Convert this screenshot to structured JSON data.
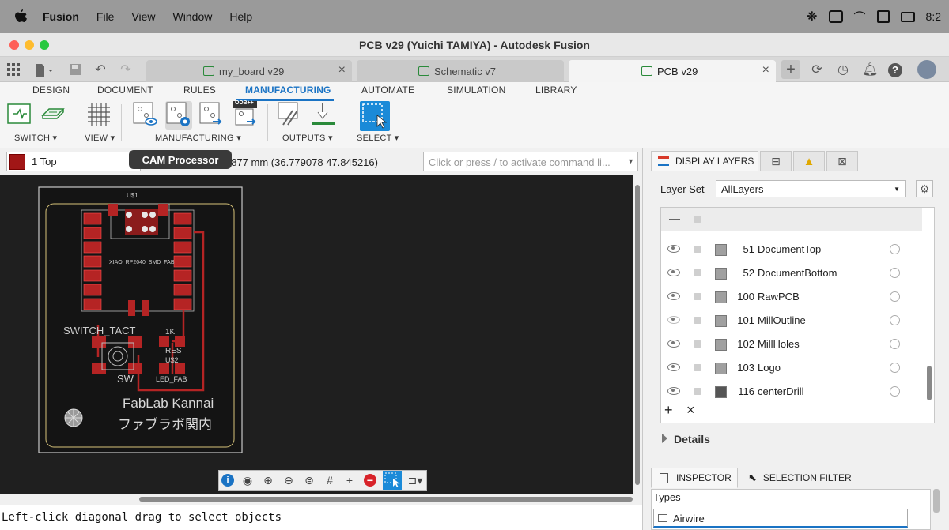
{
  "menubar": {
    "app": "Fusion",
    "items": [
      "File",
      "View",
      "Window",
      "Help"
    ],
    "clock": "8:2"
  },
  "window": {
    "title": "PCB v29 (Yuichi TAMIYA) - Autodesk Fusion"
  },
  "doc_tabs": [
    {
      "label": "my_board v29"
    },
    {
      "label": "Schematic v7"
    },
    {
      "label": "PCB v29"
    }
  ],
  "ribbon": {
    "tabs": [
      "DESIGN",
      "DOCUMENT",
      "RULES",
      "MANUFACTURING",
      "AUTOMATE",
      "SIMULATION",
      "LIBRARY"
    ],
    "active_tab": "MANUFACTURING",
    "groups": {
      "switch": "SWITCH ▾",
      "view": "VIEW ▾",
      "manufacturing": "MANUFACTURING ▾",
      "outputs": "OUTPUTS ▾",
      "select": "SELECT ▾"
    },
    "odb_badge": "ODB++"
  },
  "command_row": {
    "layer": "1 Top",
    "coords": "0877 mm (36.779078 47.845216)",
    "command_placeholder": "Click or press / to activate command li..."
  },
  "tooltip": "CAM Processor",
  "board": {
    "part_label": "U$1",
    "mcu_label": "XIAO_RP2040_SMD_FAB",
    "switch_label": "SWITCH_TACT",
    "sw_label": "SW",
    "res_value": "1K",
    "res_label": "RES",
    "led_ref": "U$2",
    "led_label": "LED_FAB",
    "text_line1": "FabLab Kannai",
    "text_line2": "ファブラボ関内"
  },
  "status": "Left-click diagonal drag to select objects",
  "right_panel": {
    "tabs": [
      "DISPLAY LAYERS"
    ],
    "layer_set_label": "Layer Set",
    "layer_set_value": "AllLayers",
    "layers": [
      {
        "num": "51",
        "name": "DocumentTop",
        "visible": true,
        "color": "#a0a0a0"
      },
      {
        "num": "52",
        "name": "DocumentBottom",
        "visible": true,
        "color": "#a0a0a0"
      },
      {
        "num": "100",
        "name": "RawPCB",
        "visible": true,
        "color": "#a0a0a0"
      },
      {
        "num": "101",
        "name": "MillOutline",
        "visible": false,
        "color": "#a0a0a0"
      },
      {
        "num": "102",
        "name": "MillHoles",
        "visible": true,
        "color": "#a0a0a0"
      },
      {
        "num": "103",
        "name": "Logo",
        "visible": true,
        "color": "#a0a0a0"
      },
      {
        "num": "116",
        "name": "centerDrill",
        "visible": true,
        "color": "#555555"
      }
    ],
    "details": "Details",
    "inspector_tab": "INSPECTOR",
    "selection_filter_tab": "SELECTION FILTER",
    "types_label": "Types",
    "types_value": "Airwire"
  },
  "colors": {
    "accent": "#1a73c4",
    "copper": "#b52424",
    "board_bg": "#1f1f1f"
  }
}
